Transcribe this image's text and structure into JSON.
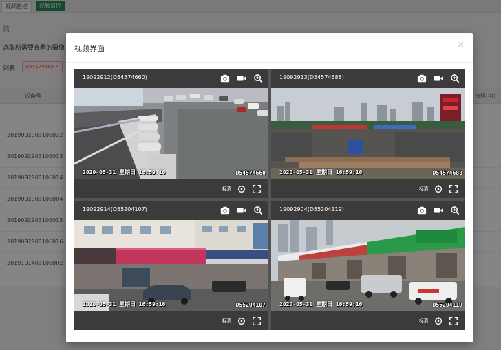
{
  "background": {
    "tabs": [
      "视频监控",
      "视频监控"
    ],
    "title": "信",
    "hint": "选取所需要查看的摄像",
    "list_label": "列表",
    "chip": "D54574660 ×",
    "table_header": "设备号",
    "right_header": "接码(可)",
    "rows": [
      "2019092903106012",
      "2019092903106013",
      "2019092903106014",
      "2019092903106004",
      "2019092903106015",
      "2019092903106016",
      "2019101403106002"
    ]
  },
  "modal": {
    "title": "视频界面",
    "close": "×"
  },
  "cameras": [
    {
      "name": "19092912(D54574660)",
      "osd_time": "2020-05-31 星期日 16:59:16",
      "osd_id": "D54574660",
      "scene": "parking-roof"
    },
    {
      "name": "19092913(D54574688)",
      "osd_time": "2020-05-31 星期日 16:59:16",
      "osd_id": "D54574688",
      "scene": "construction-yard"
    },
    {
      "name": "19092914(D55204107)",
      "osd_time": "2020-05-31 星期日 16:59:16",
      "osd_id": "D55204107",
      "scene": "street-shops"
    },
    {
      "name": "19092904(D55204119)",
      "osd_time": "2020-05-31 星期日 16:59:16",
      "osd_id": "D55204119",
      "scene": "market-street"
    }
  ],
  "controls": {
    "hd_label": "标清"
  },
  "colors": {
    "accent_green": "#2a8c53",
    "tile_bar": "#3b3b3b",
    "grid_border": "#545454"
  }
}
